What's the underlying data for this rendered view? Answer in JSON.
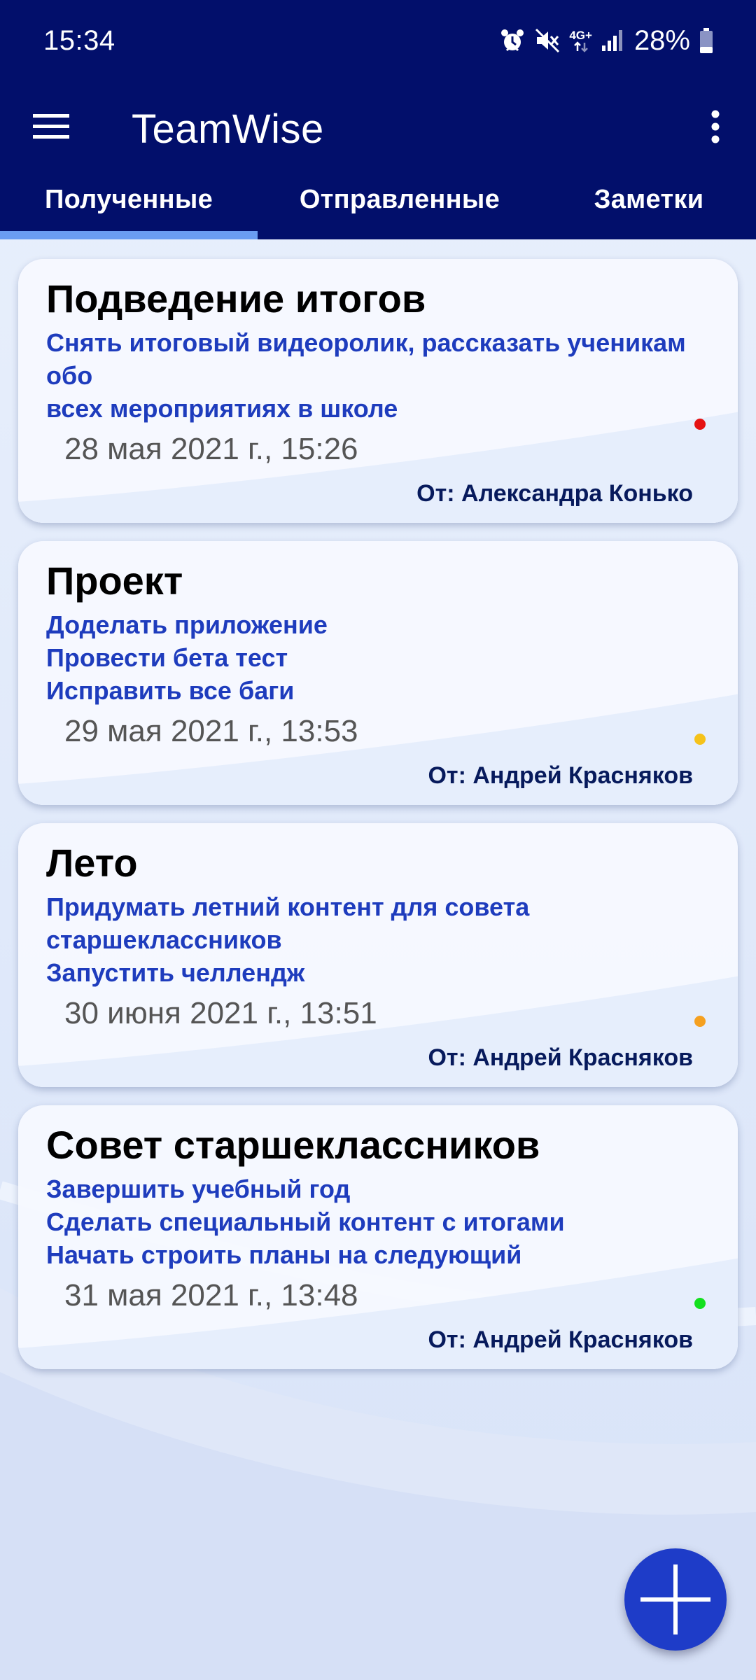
{
  "status_bar": {
    "time": "15:34",
    "network_label": "4G+",
    "battery_percent": "28%",
    "icons": [
      "alarm-icon",
      "mute-icon",
      "network-4g-icon",
      "signal-icon",
      "battery-icon"
    ],
    "battery_level": 0.28
  },
  "app_bar": {
    "title": "TeamWise",
    "menu_icon": "hamburger-menu-icon",
    "overflow_icon": "more-vert-icon",
    "background": "#020f6b"
  },
  "tabs": [
    {
      "label": "Полученные",
      "selected": true
    },
    {
      "label": "Отправленные",
      "selected": false
    },
    {
      "label": "Заметки",
      "selected": false
    }
  ],
  "tasks": [
    {
      "title": "Подведение итогов",
      "lines": [
        "Снять итоговый видеоролик, рассказать ученикам обо",
        "всех мероприятиях в школе"
      ],
      "date": "28 мая 2021 г., 15:26",
      "from": "От: Александра Конько",
      "status_color": "#e51212"
    },
    {
      "title": "Проект",
      "lines": [
        "Доделать приложение",
        "Провести бета тест",
        "Исправить все баги"
      ],
      "date": "29 мая 2021 г., 13:53",
      "from": "От: Андрей Красняков",
      "status_color": "#f5c21a"
    },
    {
      "title": "Лето",
      "lines": [
        "Придумать летний контент для совета",
        "старшеклассников",
        "Запустить челлендж"
      ],
      "date": "30 июня 2021 г., 13:51",
      "from": "От: Андрей Красняков",
      "status_color": "#f5a020"
    },
    {
      "title": "Совет старшеклассников",
      "lines": [
        "Завершить учебный год",
        "Сделать специальный контент с итогами",
        "Начать строить планы на следующий"
      ],
      "date": "31 мая 2021 г., 13:48",
      "from": "От: Андрей Красняков",
      "status_color": "#14e01e"
    }
  ],
  "fab": {
    "icon": "plus-icon",
    "color": "#1e3cc8"
  },
  "colors": {
    "accent": "#1e3cbd",
    "tab_indicator": "#6a9cf2",
    "background": "#e4ecfa"
  }
}
